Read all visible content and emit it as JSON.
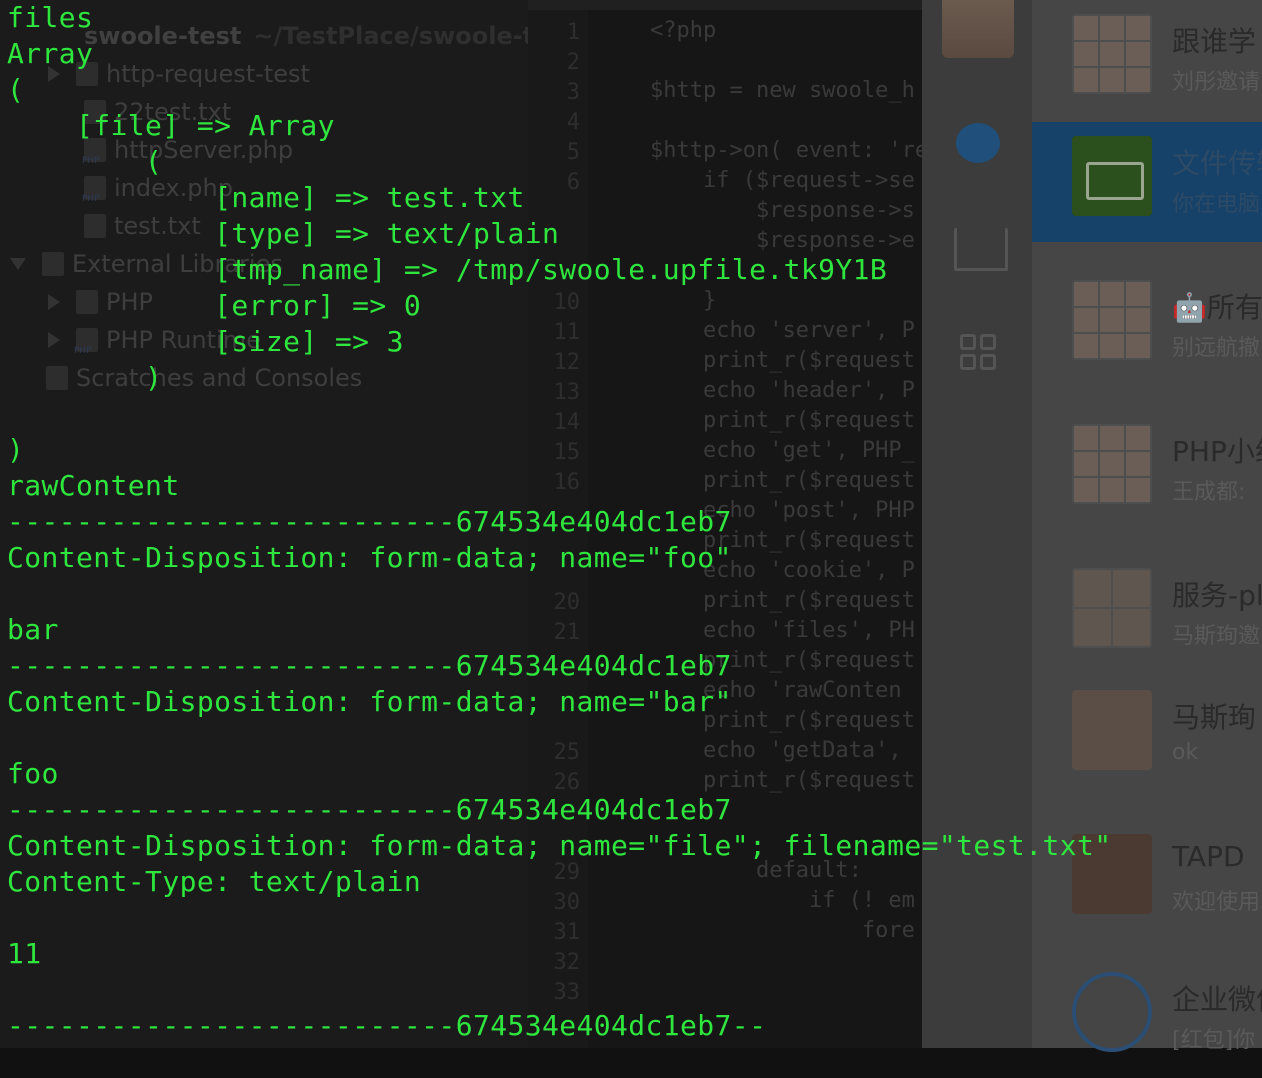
{
  "project_tree": {
    "root_name": "swoole-test",
    "root_path": "~/TestPlace/swoole-tes",
    "items": [
      {
        "label": "http-request-test"
      },
      {
        "label": "22test.txt"
      },
      {
        "label": "httpServer.php"
      },
      {
        "label": "index.php"
      },
      {
        "label": "test.txt"
      },
      {
        "label": "External Libraries"
      },
      {
        "label": "PHP"
      },
      {
        "label": "PHP Runtime"
      },
      {
        "label": "Scratches and Consoles"
      }
    ]
  },
  "editor": {
    "line_numbers": [
      "1",
      "2",
      "3",
      "4",
      "5",
      "6",
      "",
      "",
      "",
      "10",
      "11",
      "12",
      "13",
      "14",
      "15",
      "16",
      "",
      "",
      "",
      "20",
      "21",
      "",
      "",
      "",
      "25",
      "26",
      "",
      "",
      "29",
      "30",
      "31",
      "32",
      "33"
    ],
    "code_lines": [
      {
        "text": "<?php"
      },
      {
        "text": "$http = new swoole_h"
      },
      {
        "text": "$http->on( event: 're"
      },
      {
        "text": "    if ($request->se"
      },
      {
        "text": "        $response->s"
      },
      {
        "text": "        $response->e"
      },
      {
        "text": "    }"
      },
      {
        "text": "    echo 'server', P"
      },
      {
        "text": "    print_r($request"
      },
      {
        "text": "    echo 'header', P"
      },
      {
        "text": "    print_r($request"
      },
      {
        "text": "    echo 'get', PHP_"
      },
      {
        "text": "    print_r($request"
      },
      {
        "text": "    echo 'post', PHP"
      },
      {
        "text": "    print_r($request"
      },
      {
        "text": "    echo 'cookie', P"
      },
      {
        "text": "    print_r($request"
      },
      {
        "text": "    echo 'files', PH"
      },
      {
        "text": "    print_r($request"
      },
      {
        "text": "    echo 'rawConten"
      },
      {
        "text": "    print_r($request"
      },
      {
        "text": "    echo 'getData',"
      },
      {
        "text": "    print_r($request"
      },
      {
        "text": "        default:"
      },
      {
        "text": "            if (! em"
      },
      {
        "text": "                fore"
      }
    ]
  },
  "terminal": {
    "lines": [
      "files",
      "Array",
      "(",
      "    [file] => Array",
      "        (",
      "            [name] => test.txt",
      "            [type] => text/plain",
      "            [tmp_name] => /tmp/swoole.upfile.tk9Y1B",
      "            [error] => 0",
      "            [size] => 3",
      "        )",
      "",
      ")",
      "rawContent",
      "--------------------------674534e404dc1eb7",
      "Content-Disposition: form-data; name=\"foo\"",
      "",
      "bar",
      "--------------------------674534e404dc1eb7",
      "Content-Disposition: form-data; name=\"bar\"",
      "",
      "foo",
      "--------------------------674534e404dc1eb7",
      "Content-Disposition: form-data; name=\"file\"; filename=\"test.txt\"",
      "Content-Type: text/plain",
      "",
      "11",
      "",
      "--------------------------674534e404dc1eb7--"
    ],
    "text_color": "#2ee63d"
  },
  "chat_app": {
    "nav_icons": [
      "avatar",
      "chat-bubble-icon",
      "org-chart-icon",
      "apps-grid-icon"
    ],
    "conversations": [
      {
        "name": "跟谁学",
        "sub": "刘彤邀请",
        "avatar": "grid9"
      },
      {
        "name": "文件传输",
        "sub": "你在电脑",
        "avatar": "file",
        "active": true
      },
      {
        "name": "🤖所有",
        "sub": "别远航撤",
        "avatar": "grid9"
      },
      {
        "name": "PHP小组",
        "sub": "王成都:",
        "avatar": "grid9"
      },
      {
        "name": "服务-pl",
        "sub": "马斯珣邀",
        "avatar": "grid4"
      },
      {
        "name": "马斯珣",
        "sub": "ok",
        "avatar": "single"
      },
      {
        "name": "TAPD",
        "sub": "欢迎使用",
        "avatar": "tapd"
      },
      {
        "name": "企业微信",
        "sub": "[红包]你",
        "avatar": "wecom"
      }
    ]
  }
}
